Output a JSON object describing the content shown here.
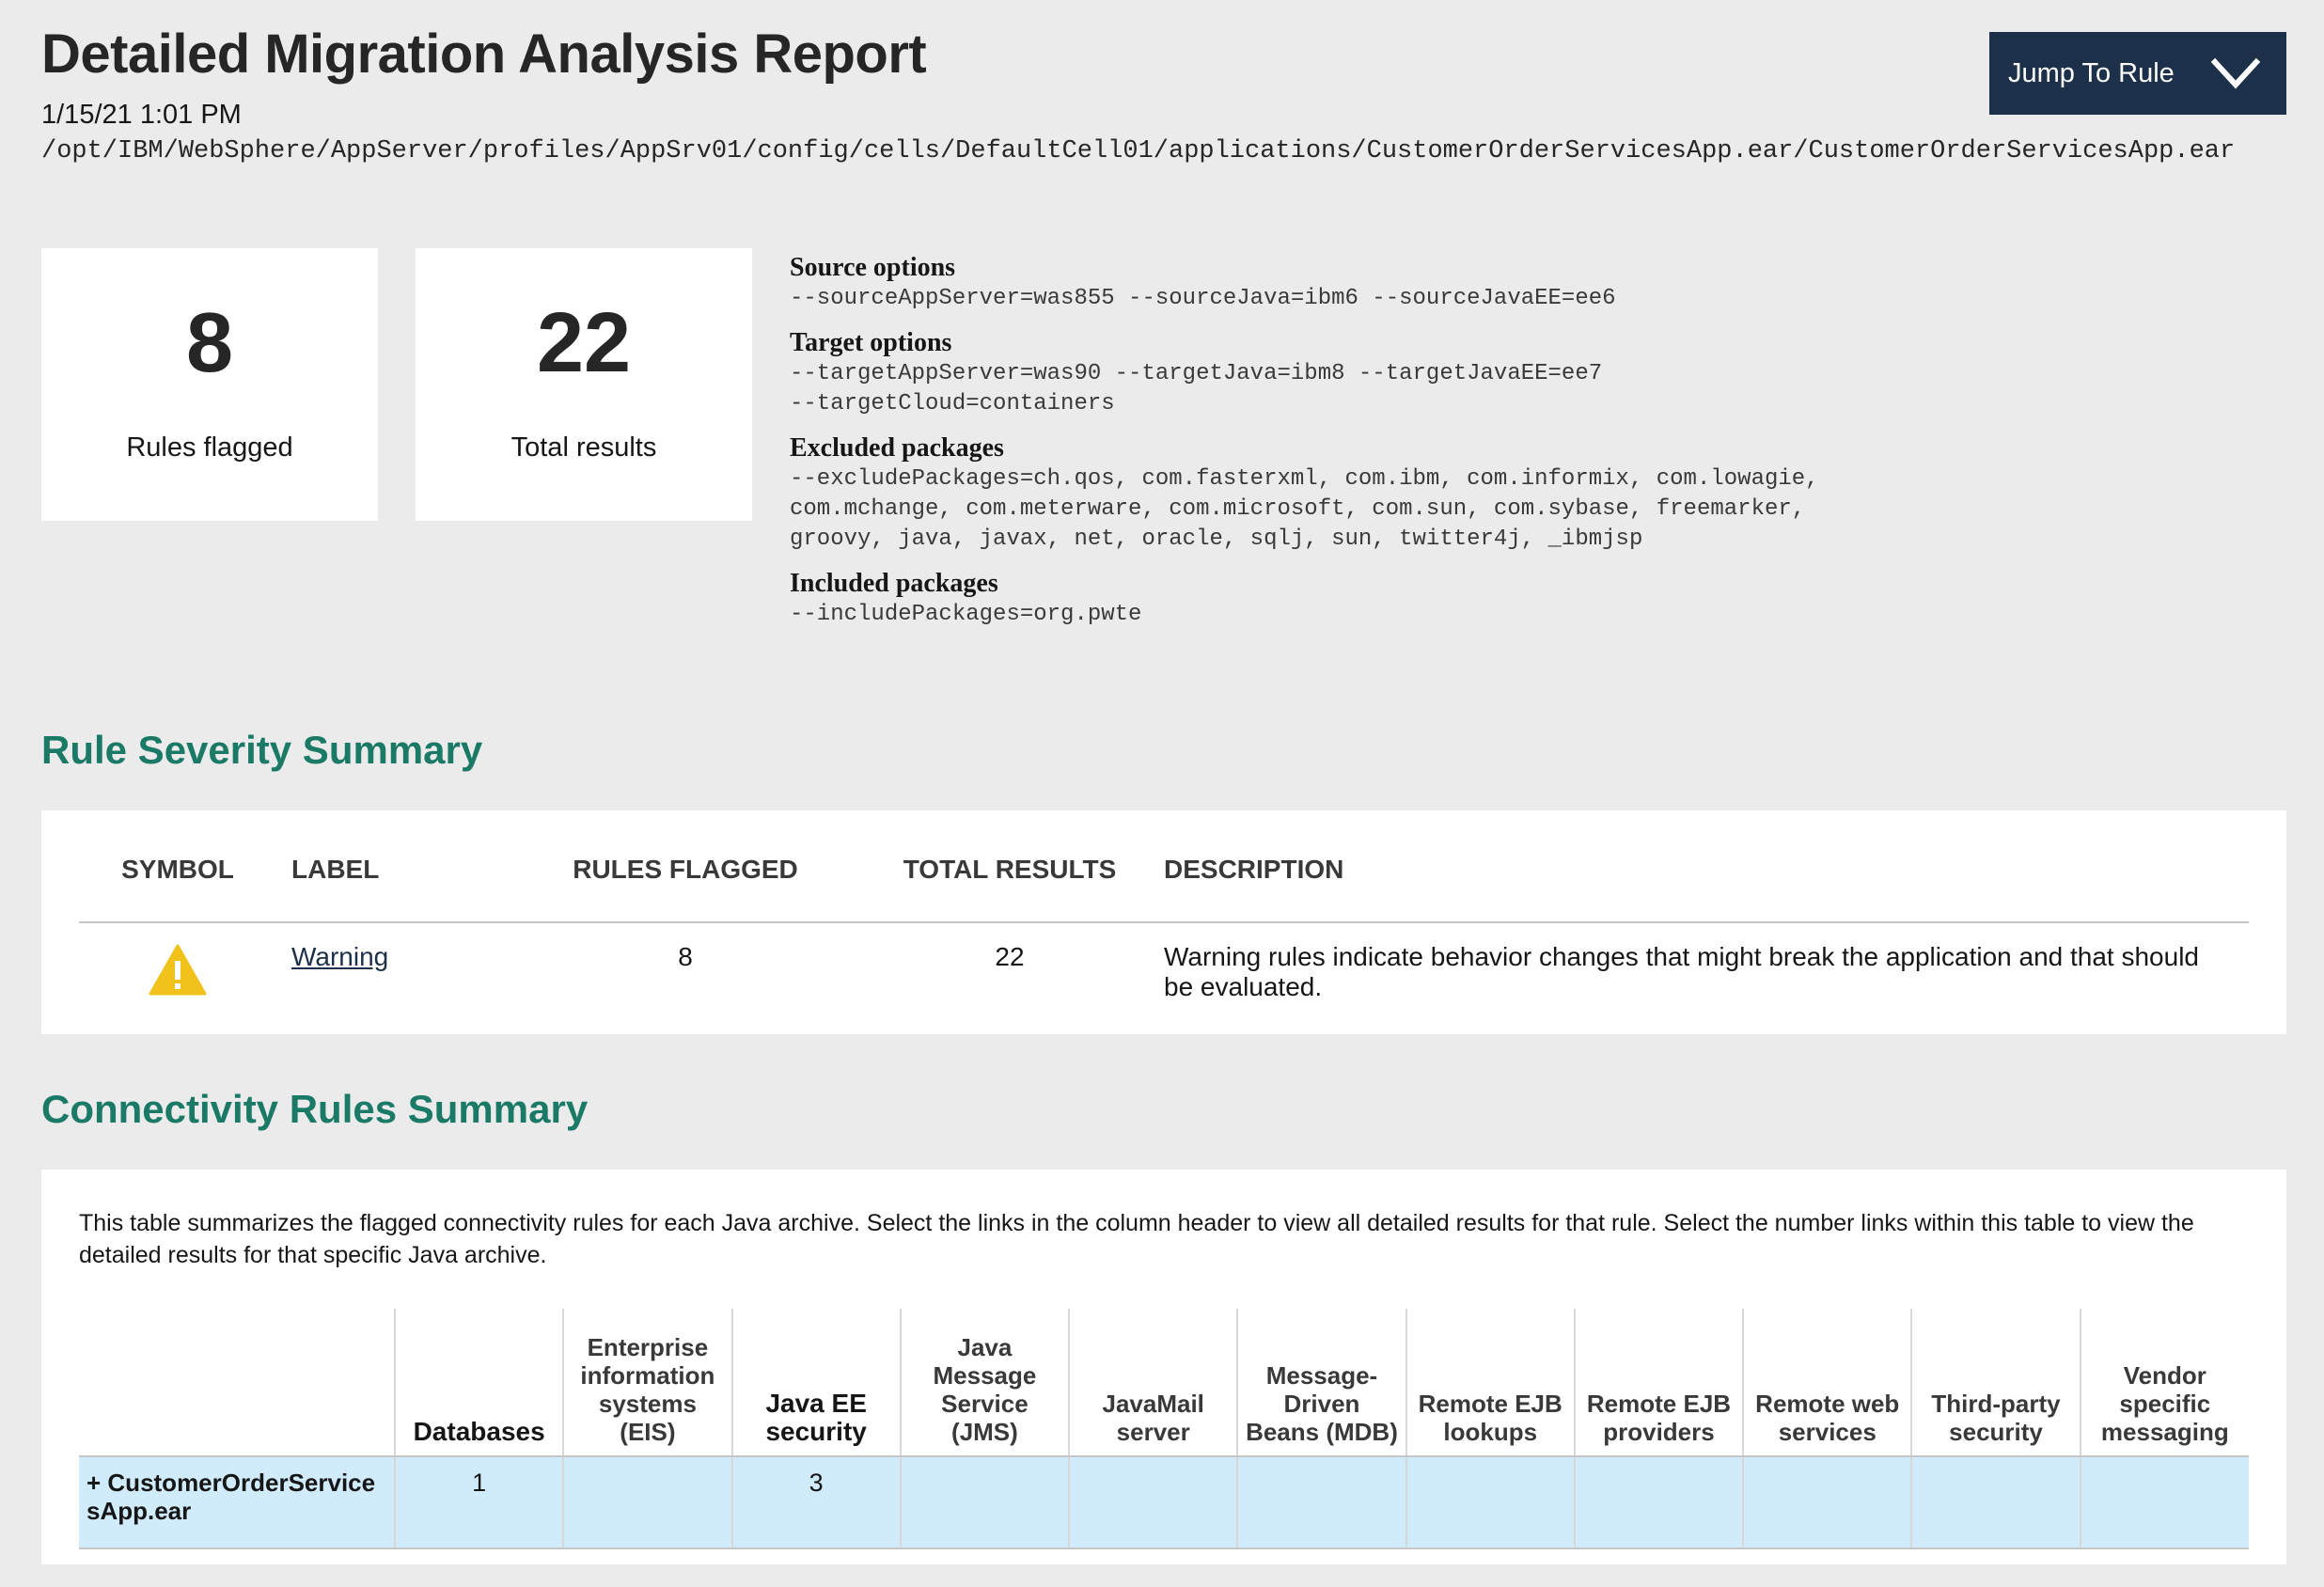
{
  "report": {
    "title": "Detailed Migration Analysis Report",
    "date": "1/15/21 1:01 PM",
    "path": "/opt/IBM/WebSphere/AppServer/profiles/AppSrv01/config/cells/DefaultCell01/applications/CustomerOrderServicesApp.ear/CustomerOrderServicesApp.ear"
  },
  "jump_button": {
    "label": "Jump To Rule",
    "icon": "chevron-down-icon"
  },
  "stats": {
    "rules_flagged": {
      "value": "8",
      "label": "Rules flagged"
    },
    "total_results": {
      "value": "22",
      "label": "Total results"
    }
  },
  "options": {
    "source": {
      "title": "Source options",
      "value": "--sourceAppServer=was855 --sourceJava=ibm6 --sourceJavaEE=ee6"
    },
    "target": {
      "title": "Target options",
      "value": "--targetAppServer=was90 --targetJava=ibm8 --targetJavaEE=ee7\n--targetCloud=containers"
    },
    "excluded": {
      "title": "Excluded packages",
      "value": "--excludePackages=ch.qos, com.fasterxml, com.ibm, com.informix, com.lowagie,\ncom.mchange, com.meterware, com.microsoft, com.sun, com.sybase, freemarker,\ngroovy, java, javax, net, oracle, sqlj, sun, twitter4j, _ibmjsp"
    },
    "included": {
      "title": "Included packages",
      "value": "--includePackages=org.pwte"
    }
  },
  "severity": {
    "heading": "Rule Severity Summary",
    "headers": {
      "symbol": "SYMBOL",
      "label": "LABEL",
      "rules_flagged": "RULES FLAGGED",
      "total_results": "TOTAL RESULTS",
      "description": "DESCRIPTION"
    },
    "rows": [
      {
        "symbol_icon": "warning-icon",
        "symbol_color": "#f1c21b",
        "label": "Warning",
        "rules_flagged": "8",
        "total_results": "22",
        "description": "Warning rules indicate behavior changes that might break the application and that should be evaluated."
      }
    ]
  },
  "connectivity": {
    "heading": "Connectivity Rules Summary",
    "intro": "This table summarizes the flagged connectivity rules for each Java archive. Select the links in the column header to view all detailed results for that rule. Select the number links within this table to view the detailed results for that specific Java archive.",
    "columns": [
      "",
      "Databases",
      "Enterprise information systems (EIS)",
      "Java EE security",
      "Java Message Service (JMS)",
      "JavaMail server",
      "Message-Driven Beans (MDB)",
      "Remote EJB lookups",
      "Remote EJB providers",
      "Remote web services",
      "Third-party security",
      "Vendor specific messaging"
    ],
    "rows": [
      {
        "archive": "+ CustomerOrderServicesApp.ear",
        "values": [
          "1",
          "",
          "3",
          "",
          "",
          "",
          "",
          "",
          "",
          "",
          ""
        ]
      }
    ]
  },
  "colors": {
    "heading_green": "#1a7a66",
    "button_navy": "#1d3049",
    "row_highlight": "#d0ebfb",
    "page_background": "#ebebeb"
  }
}
